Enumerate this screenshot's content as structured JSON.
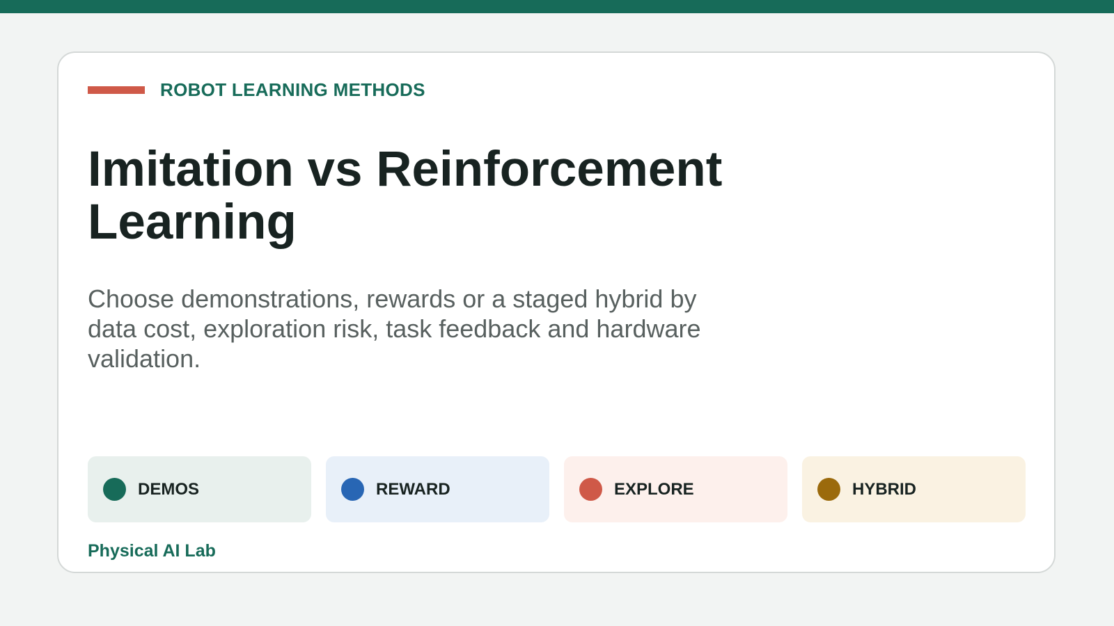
{
  "header": {
    "eyebrow": "ROBOT LEARNING METHODS",
    "accent_color": "#cf5948",
    "brand_color": "#176b59"
  },
  "main": {
    "title": "Imitation vs Reinforcement Learning",
    "subtitle": "Choose demonstrations, rewards or a staged hybrid by data cost, exploration risk, task feedback and hardware validation."
  },
  "chips": [
    {
      "label": "DEMOS",
      "dot_color": "#176b59",
      "bg_color": "#e8f0ed"
    },
    {
      "label": "REWARD",
      "dot_color": "#2866b4",
      "bg_color": "#e8f0f9"
    },
    {
      "label": "EXPLORE",
      "dot_color": "#cf5948",
      "bg_color": "#fdf0ec"
    },
    {
      "label": "HYBRID",
      "dot_color": "#9b6a0c",
      "bg_color": "#faf2e2"
    }
  ],
  "footer": {
    "label": "Physical AI Lab"
  }
}
